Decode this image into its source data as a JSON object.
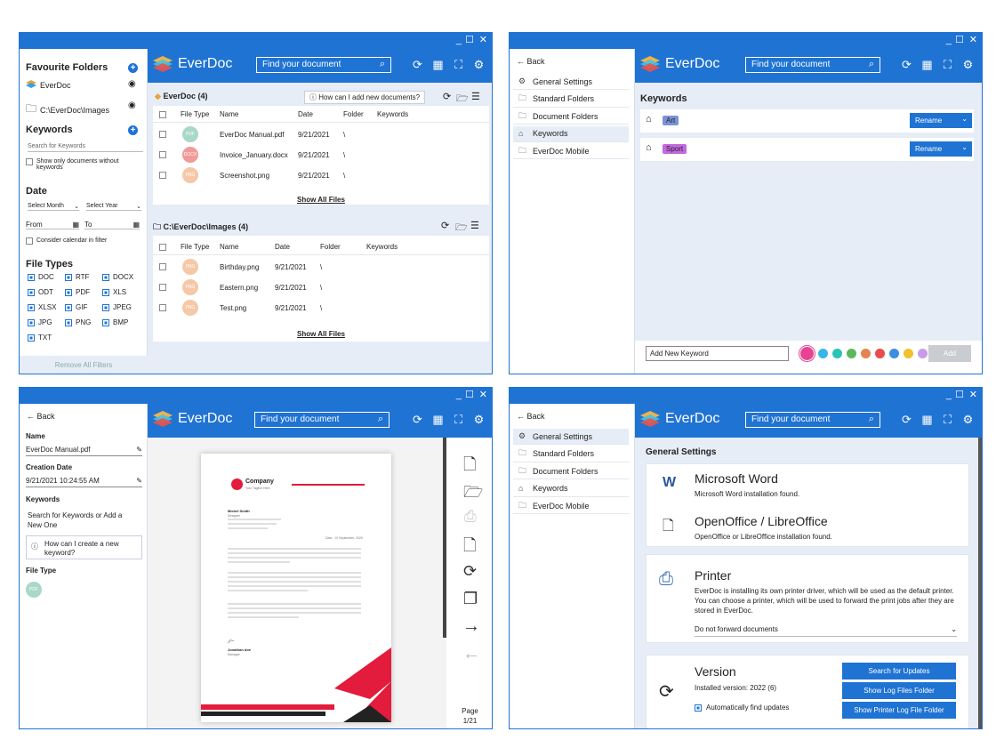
{
  "app": {
    "brand": "EverDoc",
    "search_placeholder": "Find your document",
    "colors": {
      "accent": "#1f73d3",
      "pane_bg": "#e6edf6"
    }
  },
  "window_controls": {
    "minimize": "_",
    "maximize": "☐",
    "close": "✕"
  },
  "panel1": {
    "favourite_folders": "Favourite Folders",
    "folders": [
      {
        "label": "EverDoc"
      },
      {
        "label": "C:\\EverDoc\\Images"
      }
    ],
    "keywords_title": "Keywords",
    "search_keywords": "Search for Keywords",
    "show_only_without": "Show only documents without keywords",
    "date_title": "Date",
    "select_month": "Select Month",
    "select_year": "Select Year",
    "from": "From",
    "to": "To",
    "consider_calendar": "Consider calendar in filter",
    "file_types_title": "File Types",
    "file_types": [
      "DOC",
      "RTF",
      "DOCX",
      "ODT",
      "PDF",
      "XLS",
      "XLSX",
      "GIF",
      "JPEG",
      "JPG",
      "PNG",
      "BMP",
      "TXT"
    ],
    "remove_filters": "Remove All Filters",
    "group1": {
      "title": "EverDoc (4)",
      "help": "How can I add new documents?",
      "columns": [
        "File Type",
        "Name",
        "Date",
        "Folder",
        "Keywords"
      ],
      "rows": [
        {
          "type": "PDF",
          "name": "EverDoc Manual.pdf",
          "date": "9/21/2021",
          "folder": "\\"
        },
        {
          "type": "DOCX",
          "name": "Invoice_January.docx",
          "date": "9/21/2021",
          "folder": "\\"
        },
        {
          "type": "PNG",
          "name": "Screenshot.png",
          "date": "9/21/2021",
          "folder": "\\"
        }
      ],
      "show_all": "Show All Files"
    },
    "group2": {
      "title": "C:\\EverDoc\\Images (4)",
      "columns": [
        "File Type",
        "Name",
        "Date",
        "Folder",
        "Keywords"
      ],
      "rows": [
        {
          "type": "PNG",
          "name": "Birthday.png",
          "date": "9/21/2021",
          "folder": "\\"
        },
        {
          "type": "PNG",
          "name": "Eastern.png",
          "date": "9/21/2021",
          "folder": "\\"
        },
        {
          "type": "PNG",
          "name": "Test.png",
          "date": "9/21/2021",
          "folder": "\\"
        }
      ],
      "show_all": "Show All Files"
    }
  },
  "panel2": {
    "back": "Back",
    "nav": [
      "General Settings",
      "Standard Folders",
      "Document Folders",
      "Keywords",
      "EverDoc Mobile"
    ],
    "title": "Keywords",
    "keywords": [
      {
        "label": "Art",
        "color": "#7b93d6"
      },
      {
        "label": "Sport",
        "color": "#c268e0"
      }
    ],
    "rename": "Rename",
    "add_placeholder": "Add New Keyword",
    "add": "Add",
    "palette": [
      "#e84393",
      "#38b6e8",
      "#2bc4b4",
      "#5cb85c",
      "#e5844f",
      "#e84c4c",
      "#3b8fe0",
      "#f0c02e",
      "#c89be8"
    ]
  },
  "panel3": {
    "back": "Back",
    "name_label": "Name",
    "name_value": "EverDoc Manual.pdf",
    "creation_label": "Creation Date",
    "creation_value": "9/21/2021 10:24:55 AM",
    "keywords_label": "Keywords",
    "keywords_placeholder": "Search for Keywords or Add a New One",
    "help": "How can I create a new keyword?",
    "file_type_label": "File Type",
    "file_type": "PDF",
    "page_label": "Page",
    "page_value": "1/21",
    "doc": {
      "company": "Company",
      "tagline": "Your Tagline Here",
      "author": "Michel Smith",
      "author_role": "Designer",
      "date": "Date : 10 September, 2020",
      "signer": "Jonathan doe",
      "signer_role": "Manager"
    }
  },
  "panel4": {
    "back": "Back",
    "nav": [
      "General Settings",
      "Standard Folders",
      "Document Folders",
      "Keywords",
      "EverDoc Mobile"
    ],
    "title": "General Settings",
    "word_title": "Microsoft Word",
    "word_status": "Microsoft Word installation found.",
    "oo_title": "OpenOffice / LibreOffice",
    "oo_status": "OpenOffice or LibreOffice installation found.",
    "printer_title": "Printer",
    "printer_text": "EverDoc is installing its own printer driver, which will be used as the default printer. You can choose a printer, which will be used to forward the print jobs after they are stored in EverDoc.",
    "printer_select": "Do not forward documents",
    "version_title": "Version",
    "version_text": "Installed version: 2022 (6)",
    "auto_updates": "Automatically find updates",
    "btn_updates": "Search for Updates",
    "btn_log": "Show Log Files Folder",
    "btn_printer_log": "Show Printer Log File Folder"
  }
}
